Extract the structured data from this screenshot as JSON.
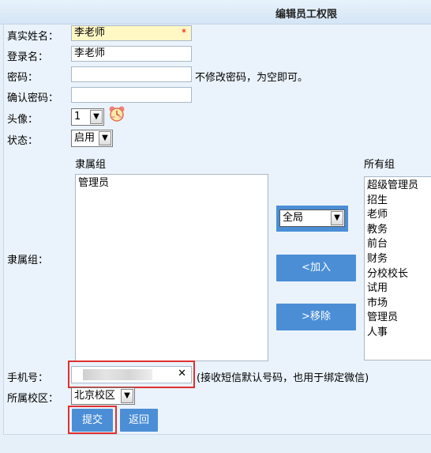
{
  "header": {
    "title": "编辑员工权限"
  },
  "form": {
    "real_name_label": "真实姓名：",
    "real_name_value": "李老师",
    "required_mark": "*",
    "login_label": "登录名：",
    "login_value": "李老师",
    "password_label": "密码：",
    "password_hint": "不修改密码，为空即可。",
    "confirm_label": "确认密码：",
    "avatar_label": "头像：",
    "avatar_value": "1",
    "status_label": "状态：",
    "status_value": "启用",
    "group_label": "隶属组：",
    "own_group_header": "隶属组",
    "all_group_header": "所有组",
    "own_groups": [
      "管理员"
    ],
    "scope_value": "全局",
    "add_button": "<加入",
    "remove_button": ">移除",
    "all_groups": [
      "超级管理员",
      "招生",
      "老师",
      "教务",
      "前台",
      "财务",
      "分校校长",
      "试用",
      "市场",
      "管理员",
      "人事"
    ],
    "phone_label": "手机号：",
    "phone_clear": "✕",
    "phone_hint": "(接收短信默认号码，也用于绑定微信)",
    "campus_label": "所属校区：",
    "campus_value": "北京校区",
    "submit_button": "提交",
    "back_button": "返回"
  },
  "colors": {
    "accent": "#4b8ed6",
    "highlight_frame": "#e03030",
    "required_field": "#fff8c4"
  },
  "icons": {
    "avatar": "clock-face-icon",
    "dropdown": "chevron-down-icon"
  }
}
